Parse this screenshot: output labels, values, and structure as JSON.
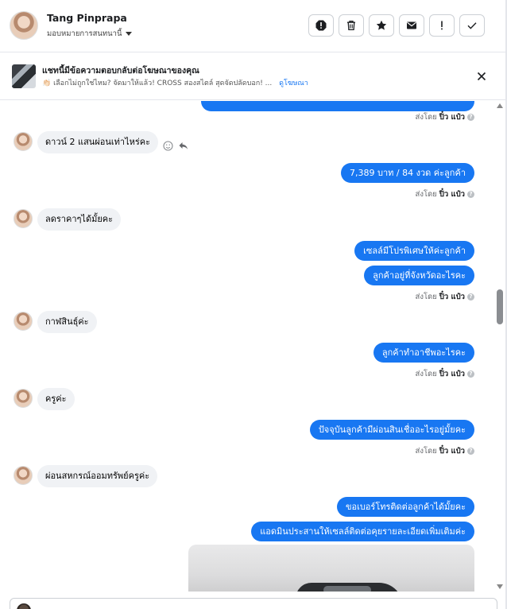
{
  "header": {
    "contact_name": "Tang Pinprapa",
    "assign_label": "มอบหมายการสนทนานี้",
    "actions": [
      {
        "name": "spam-icon"
      },
      {
        "name": "trash-icon"
      },
      {
        "name": "star-icon"
      },
      {
        "name": "mail-icon"
      },
      {
        "name": "exclamation-icon"
      },
      {
        "name": "check-icon"
      }
    ]
  },
  "ad": {
    "title": "แชทนี้มีข้อความตอบกลับต่อโฆษณาของคุณ",
    "subtitle": "👏🏻 เลือกไม่ถูกใช่ไหม? จัดมาให้แล้ว! CROSS สองสไตล์ สุดจัดปลัดบอก! ...",
    "link": "ดูโฆษณา"
  },
  "messages": [
    {
      "dir": "out",
      "text": "",
      "partial": true
    },
    {
      "dir": "sentby",
      "prefix": "ส่งโดย",
      "name": "ปิ๋ว แป๋ว"
    },
    {
      "dir": "in",
      "text": "ดาวน์ 2 แสนผ่อนเท่าไหร่คะ"
    },
    {
      "dir": "out",
      "text": "7,389 บาท   / 84 งวด   ค่ะลูกค้า"
    },
    {
      "dir": "sentby",
      "prefix": "ส่งโดย",
      "name": "ปิ๋ว แป๋ว"
    },
    {
      "dir": "in",
      "text": "ลดราคาๆได้มั้ยคะ"
    },
    {
      "dir": "out",
      "text": "เซลล์มีโปรพิเศษให้ค่ะลูกค้า"
    },
    {
      "dir": "out",
      "text": "ลูกค้าอยู่ที่จังหวัดอะไรคะ"
    },
    {
      "dir": "sentby",
      "prefix": "ส่งโดย",
      "name": "ปิ๋ว แป๋ว"
    },
    {
      "dir": "in",
      "text": "กาฬสินธุ์ค่ะ"
    },
    {
      "dir": "out",
      "text": "ลูกค้าทำอาชีพอะไรคะ"
    },
    {
      "dir": "sentby",
      "prefix": "ส่งโดย",
      "name": "ปิ๋ว แป๋ว"
    },
    {
      "dir": "in",
      "text": "ครูค่ะ"
    },
    {
      "dir": "out",
      "text": "ปัจจุบันลูกค้ามีผ่อนสินเชื่ออะไรอยู่มั้ยคะ"
    },
    {
      "dir": "sentby",
      "prefix": "ส่งโดย",
      "name": "ปิ๋ว แป๋ว"
    },
    {
      "dir": "in",
      "text": "ผ่อนสหกรณ์ออมทรัพย์ครูค่ะ"
    },
    {
      "dir": "out",
      "text": "ขอเบอร์โทรติดต่อลูกค้าได้มั้ยคะ"
    },
    {
      "dir": "out",
      "text": "แอดมินประสานให้เซลล์ติดต่อคุยรายละเอียดเพิ่มเติมค่ะ"
    }
  ],
  "colors": {
    "outgoing": "#1877f2",
    "incoming": "#f0f2f5"
  }
}
